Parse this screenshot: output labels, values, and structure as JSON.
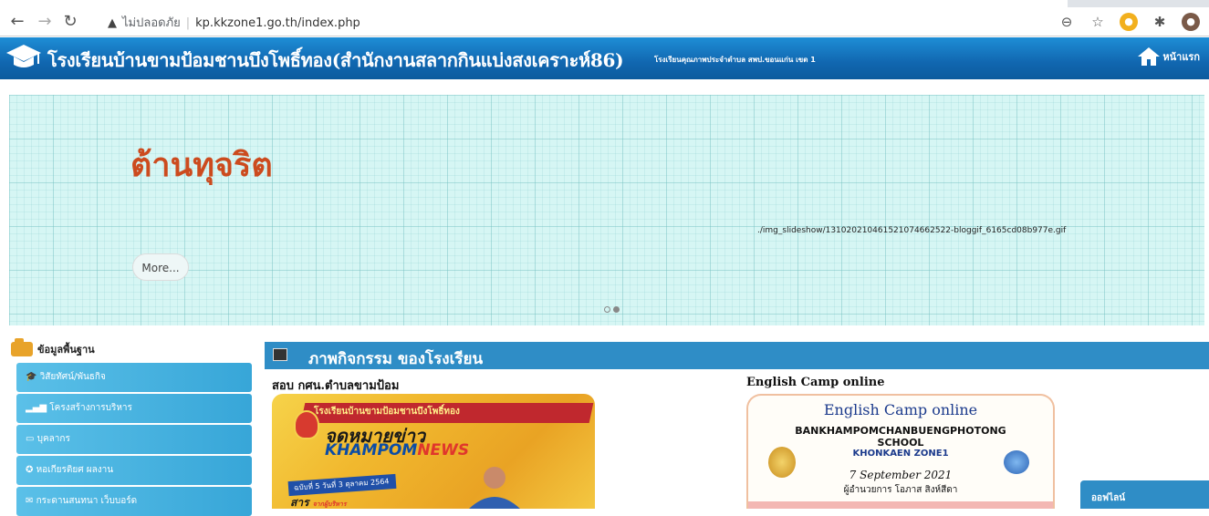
{
  "browser": {
    "back_icon": "arrow-left-icon",
    "forward_icon": "arrow-right-icon",
    "reload_icon": "reload-icon",
    "security_label": "ไม่ปลอดภัย",
    "url": "kp.kkzone1.go.th/index.php"
  },
  "header": {
    "title": "โรงเรียนบ้านขามป้อมชานบึงโพธิ์ทอง(สำนักงานสลากกินแบ่งสงเคราะห์86)",
    "subtitle": "โรงเรียนคุณภาพประจำตำบล สพป.ขอนแก่น เขต 1",
    "home_label": "หน้าแรก"
  },
  "slideshow": {
    "title": "ต้านทุจริต",
    "image_path": "./img_slideshow/131020210461521074662522-bloggif_6165cd08b977e.gif",
    "more_label": "More..."
  },
  "sidebar": {
    "heading": "ข้อมูลพื้นฐาน",
    "items": [
      {
        "label": "วิสัยทัศน์/พันธกิจ"
      },
      {
        "label": "โครงสร้างการบริหาร"
      },
      {
        "label": "บุคลากร"
      },
      {
        "label": "หอเกียรติยศ ผลงาน"
      },
      {
        "label": "กระดานสนทนา เว็บบอร์ด"
      }
    ]
  },
  "section": {
    "title": "ภาพกิจกรรม ของโรงเรียน"
  },
  "cards": [
    {
      "title": "สอบ กศน.ตำบลขามป้อม",
      "banner": "โรงเรียนบ้านขามป้อมชานบึงโพธิ์ทอง",
      "news_thai": "จดหมายข่าว",
      "news_en_a": "KHAMPOM",
      "news_en_b": "NEWS",
      "issue": "ฉบับที่ 5  วันที่ 3 ตุลาคม 2564",
      "memo": "สาร",
      "memo_sub": "จากผู้บริหาร"
    },
    {
      "title": "English Camp online",
      "img_title": "English Camp online",
      "school_line1": "BANKHAMPOMCHANBUENGPHOTONG",
      "school_line2": "SCHOOL",
      "zone": "KHONKAEN ZONE1",
      "date": "7 September 2021",
      "director": "ผู้อำนวยการ โอภาส สิงห์สีดา"
    }
  ],
  "online_label": "ออฟไลน์"
}
